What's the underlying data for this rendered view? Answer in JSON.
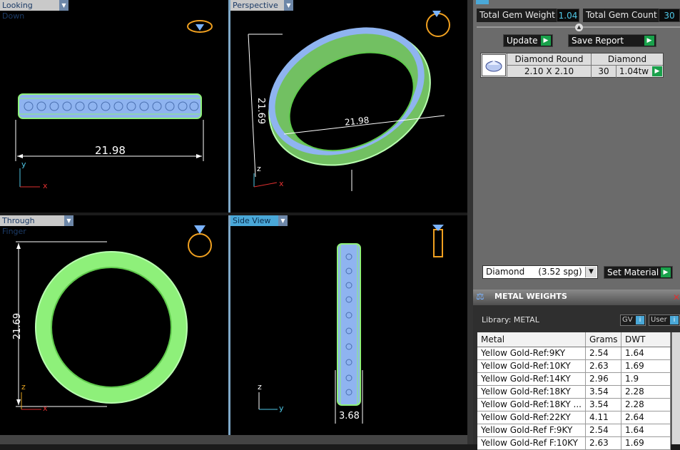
{
  "viewports": [
    {
      "id": "top",
      "tab": "Looking Down",
      "dimension": "21.98",
      "axes": [
        "y",
        "x"
      ]
    },
    {
      "id": "persp",
      "tab": "Perspective",
      "dimensions": [
        "21.69",
        "21.98"
      ],
      "axes": [
        "z",
        "x"
      ]
    },
    {
      "id": "front",
      "tab": "Through Finger",
      "dimension": "21.69",
      "axes": [
        "z",
        "x"
      ]
    },
    {
      "id": "side",
      "tab": "Side View",
      "dimension": "3.68",
      "axes": [
        "z",
        "y"
      ]
    }
  ],
  "summary": {
    "total_gem_weight_label": "Total Gem Weight",
    "total_gem_weight": "1.04",
    "total_gem_count_label": "Total Gem Count",
    "total_gem_count": "30",
    "update_label": "Update",
    "save_report_label": "Save Report"
  },
  "gem": {
    "shape": "Diamond Round",
    "size": "2.10 X 2.10",
    "material": "Diamond",
    "count": "30",
    "weight": "1.04tw"
  },
  "material_select": {
    "value": "Diamond     (3.52 spg)",
    "button": "Set Material"
  },
  "metal_weights": {
    "title": "METAL WEIGHTS",
    "library_label": "Library: METAL",
    "gv_label": "GV",
    "user_label": "User",
    "columns": [
      "Metal",
      "Grams",
      "DWT"
    ],
    "rows": [
      {
        "metal": "Yellow Gold-Ref:9KY",
        "grams": "2.54",
        "dwt": "1.64"
      },
      {
        "metal": "Yellow Gold-Ref:10KY",
        "grams": "2.63",
        "dwt": "1.69"
      },
      {
        "metal": "Yellow Gold-Ref:14KY",
        "grams": "2.96",
        "dwt": "1.9"
      },
      {
        "metal": "Yellow Gold-Ref:18KY",
        "grams": "3.54",
        "dwt": "2.28"
      },
      {
        "metal": "Yellow Gold-Ref:18KY ...",
        "grams": "3.54",
        "dwt": "2.28"
      },
      {
        "metal": "Yellow Gold-Ref:22KY",
        "grams": "4.11",
        "dwt": "2.64"
      },
      {
        "metal": "Yellow Gold-Ref F:9KY",
        "grams": "2.54",
        "dwt": "1.64"
      },
      {
        "metal": "Yellow Gold-Ref F:10KY",
        "grams": "2.63",
        "dwt": "1.69"
      }
    ]
  },
  "colors": {
    "ring": "#8ef07a",
    "gem": "#8fb4f0",
    "accent": "#4fc7e6",
    "go": "#19a14b"
  }
}
